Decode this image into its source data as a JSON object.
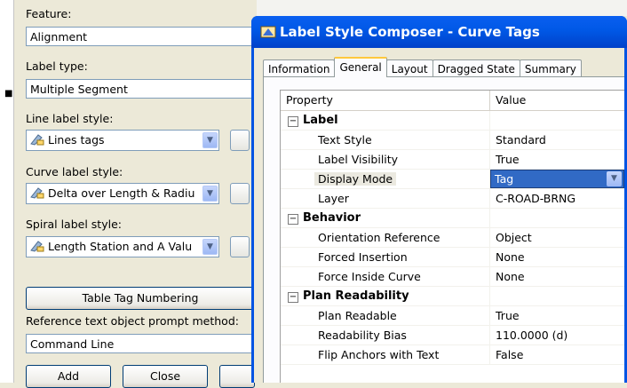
{
  "background_dialog": {
    "feature_label": "Feature:",
    "feature_value": "Alignment",
    "label_type_label": "Label type:",
    "label_type_value": "Multiple Segment",
    "line_label_style_label": "Line label style:",
    "line_label_style_value": "Lines tags",
    "curve_label_style_label": "Curve label style:",
    "curve_label_style_value": "Delta over Length & Radiu",
    "spiral_label_style_label": "Spiral label style:",
    "spiral_label_style_value": "Length Station and A Valu",
    "table_tag_numbering_button": "Table Tag Numbering",
    "reference_prompt_label": "Reference text object prompt method:",
    "reference_prompt_value": "Command Line",
    "add_button": "Add",
    "close_button": "Close"
  },
  "composer": {
    "title": "Label Style Composer - Curve Tags",
    "tabs": [
      "Information",
      "General",
      "Layout",
      "Dragged State",
      "Summary"
    ],
    "active_tab": "General",
    "grid": {
      "header_property": "Property",
      "header_value": "Value",
      "categories": [
        {
          "name": "Label",
          "rows": [
            {
              "property": "Text Style",
              "value": "Standard"
            },
            {
              "property": "Label Visibility",
              "value": "True"
            },
            {
              "property": "Display Mode",
              "value": "Tag"
            },
            {
              "property": "Layer",
              "value": "C-ROAD-BRNG"
            }
          ]
        },
        {
          "name": "Behavior",
          "rows": [
            {
              "property": "Orientation Reference",
              "value": "Object"
            },
            {
              "property": "Forced Insertion",
              "value": "None"
            },
            {
              "property": "Force Inside Curve",
              "value": "None"
            }
          ]
        },
        {
          "name": "Plan Readability",
          "rows": [
            {
              "property": "Plan Readable",
              "value": "True"
            },
            {
              "property": "Readability Bias",
              "value": "110.0000 (d)"
            },
            {
              "property": "Flip Anchors with Text",
              "value": "False"
            }
          ]
        }
      ]
    }
  },
  "colors": {
    "title_bar": "#0054e3",
    "dialog_face": "#ece9d8",
    "selection": "#316ac5"
  }
}
